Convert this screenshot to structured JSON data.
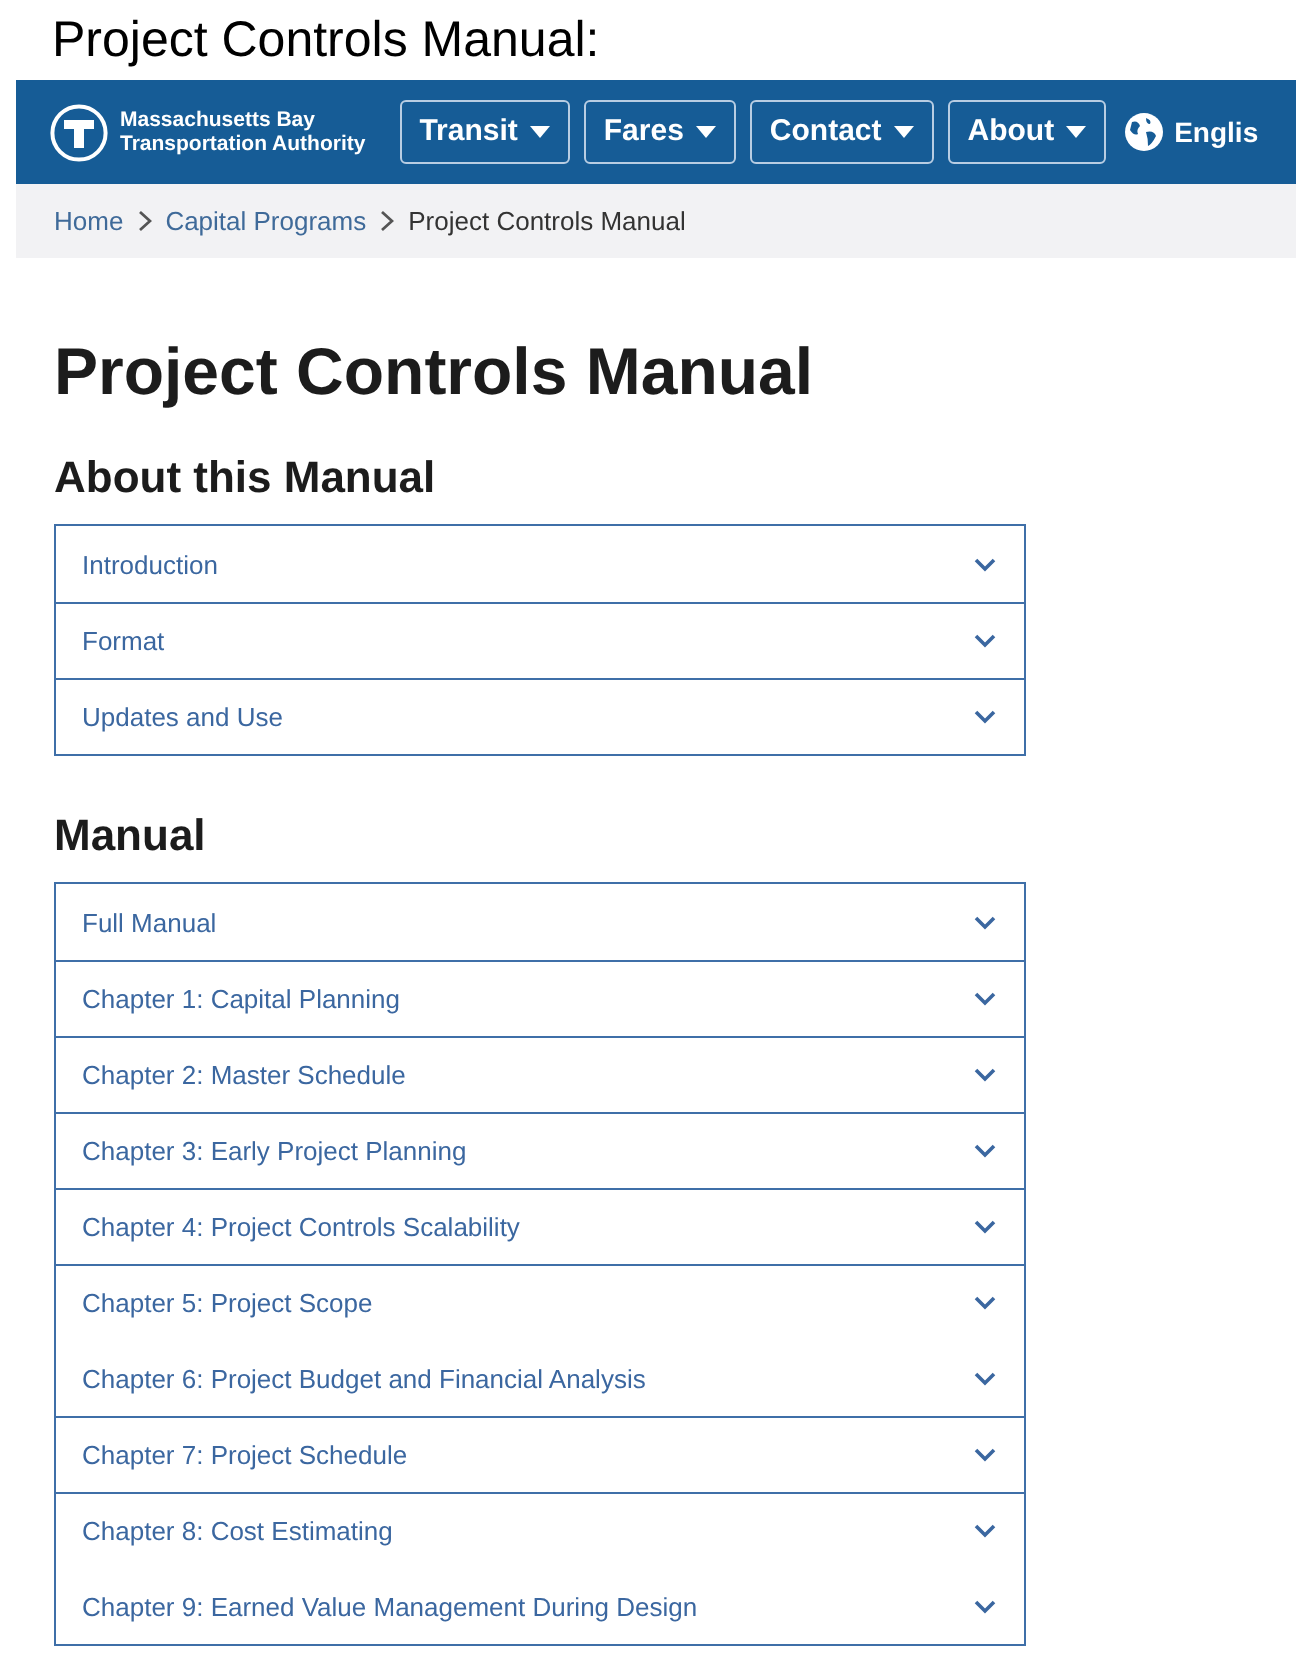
{
  "caption": "Project Controls Manual:",
  "header": {
    "logo_line_1": "Massachusetts Bay",
    "logo_line_2": "Transportation Authority",
    "nav": [
      "Transit",
      "Fares",
      "Contact",
      "About"
    ],
    "language": "Englis"
  },
  "breadcrumb": [
    {
      "label": "Home",
      "current": false
    },
    {
      "label": "Capital Programs",
      "current": false
    },
    {
      "label": "Project Controls Manual",
      "current": true
    }
  ],
  "title": "Project Controls Manual",
  "sections": [
    {
      "heading": "About this Manual",
      "items": [
        {
          "label": "Introduction",
          "divided": false
        },
        {
          "label": "Format",
          "divided": true
        },
        {
          "label": "Updates and Use",
          "divided": true
        }
      ]
    },
    {
      "heading": "Manual",
      "items": [
        {
          "label": "Full Manual",
          "divided": false
        },
        {
          "label": "Chapter 1: Capital Planning",
          "divided": true
        },
        {
          "label": "Chapter 2: Master Schedule",
          "divided": true
        },
        {
          "label": "Chapter 3: Early Project Planning",
          "divided": true
        },
        {
          "label": "Chapter 4: Project Controls Scalability",
          "divided": true
        },
        {
          "label": "Chapter 5: Project Scope",
          "divided": true
        },
        {
          "label": "Chapter 6: Project Budget and Financial Analysis",
          "divided": false
        },
        {
          "label": "Chapter 7: Project Schedule",
          "divided": true
        },
        {
          "label": "Chapter 8: Cost Estimating",
          "divided": true
        },
        {
          "label": "Chapter 9: Earned Value Management During Design",
          "divided": false
        }
      ]
    }
  ]
}
